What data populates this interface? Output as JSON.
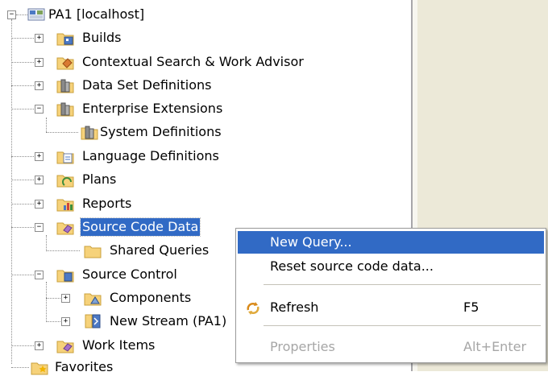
{
  "tree": {
    "root": {
      "label": "PA1 [localhost]",
      "icon": "project-server-icon",
      "expander": "−"
    },
    "items": [
      {
        "label": "Builds",
        "icon": "builds-folder-icon",
        "expander": "+"
      },
      {
        "label": "Contextual Search & Work Advisor",
        "icon": "search-advisor-folder-icon",
        "expander": "+"
      },
      {
        "label": "Data Set Definitions",
        "icon": "dataset-folder-icon",
        "expander": "+"
      },
      {
        "label": "Enterprise Extensions",
        "icon": "enterprise-folder-icon",
        "expander": "−"
      },
      {
        "label": "System Definitions",
        "icon": "system-definitions-icon"
      },
      {
        "label": "Language Definitions",
        "icon": "language-folder-icon",
        "expander": "+"
      },
      {
        "label": "Plans",
        "icon": "plans-folder-icon",
        "expander": "+"
      },
      {
        "label": "Reports",
        "icon": "reports-folder-icon",
        "expander": "+"
      },
      {
        "label": "Source Code Data",
        "icon": "source-code-data-folder-icon",
        "expander": "−",
        "selected": true
      },
      {
        "label": "Shared Queries",
        "icon": "folder-icon"
      },
      {
        "label": "Source Control",
        "icon": "source-control-folder-icon",
        "expander": "−"
      },
      {
        "label": "Components",
        "icon": "components-folder-icon",
        "expander": "+"
      },
      {
        "label": "New Stream (PA1)",
        "icon": "stream-icon",
        "expander": "+"
      },
      {
        "label": "Work Items",
        "icon": "work-items-folder-icon",
        "expander": "+"
      },
      {
        "label": "Favorites",
        "icon": "favorites-folder-icon"
      }
    ]
  },
  "context_menu": {
    "items": [
      {
        "label": "New Query...",
        "accel": "",
        "highlighted": true
      },
      {
        "label": "Reset source code data...",
        "accel": ""
      },
      {
        "label": "Refresh",
        "accel": "F5",
        "icon": "refresh-icon"
      },
      {
        "label": "Properties",
        "accel": "Alt+Enter",
        "disabled": true
      }
    ]
  },
  "colors": {
    "selection": "#316ac5",
    "folder": "#f6d27a",
    "panel": "#ece9d8",
    "disabled_text": "#a6a6a6"
  }
}
